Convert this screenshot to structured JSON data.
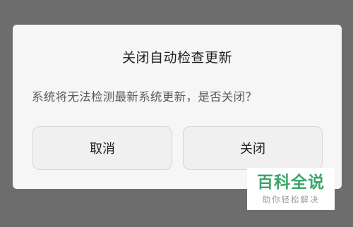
{
  "dialog": {
    "title": "关闭自动检查更新",
    "message": "系统将无法检测最新系统更新，是否关闭？",
    "cancel_label": "取消",
    "confirm_label": "关闭"
  },
  "watermark": {
    "title": "百科全说",
    "subtitle": "助你轻松解决"
  },
  "colors": {
    "overlay": "#6d6d6d",
    "dialog_bg": "#f6f6f6",
    "watermark_green": "#3aa66a"
  }
}
